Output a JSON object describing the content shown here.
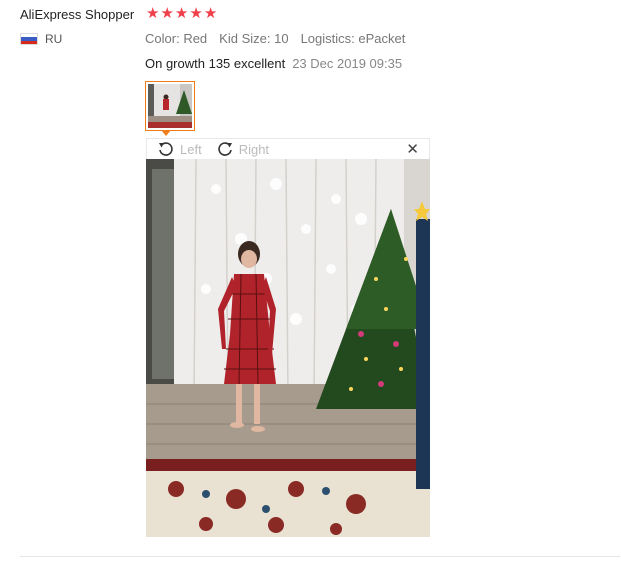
{
  "review": {
    "user": "AliExpress Shopper",
    "rating": 5,
    "stars": [
      "★",
      "★",
      "★",
      "★",
      "★"
    ],
    "country": "RU",
    "attributes": [
      {
        "label": "Color:",
        "value": "Red"
      },
      {
        "label": "Kid Size:",
        "value": "10"
      },
      {
        "label": "Logistics:",
        "value": "ePacket"
      }
    ],
    "text": "On growth 135 excellent",
    "date": "23 Dec 2019 09:35"
  },
  "viewer": {
    "rotate_left_label": "Left",
    "rotate_right_label": "Right",
    "close_label": "✕"
  },
  "colors": {
    "star": "#f2404a",
    "thumb_border": "#f07d1c"
  }
}
